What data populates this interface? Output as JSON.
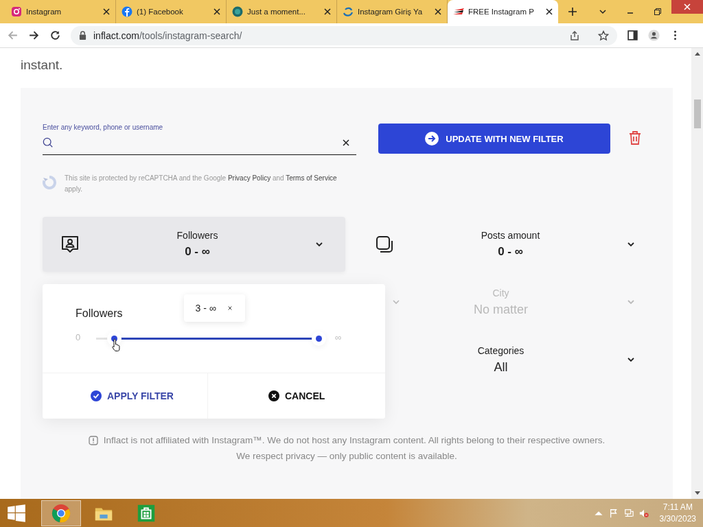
{
  "browser": {
    "tabs": [
      {
        "title": "Instagram",
        "selected": false
      },
      {
        "title": "(1) Facebook",
        "selected": false
      },
      {
        "title": "Just a moment...",
        "selected": false
      },
      {
        "title": "Instagram Giriş Ya",
        "selected": false
      },
      {
        "title": "FREE Instagram P",
        "selected": true
      }
    ],
    "address_host": "inflact.com",
    "address_path": "/tools/instagram-search/"
  },
  "page": {
    "intro_tail": "instant.",
    "search": {
      "label": "Enter any keyword, phone or username"
    },
    "update_button": "UPDATE WITH NEW FILTER",
    "recaptcha": {
      "before": "This site is protected by reCAPTCHA and the Google",
      "privacy_link": "Privacy Policy",
      "middle": "and",
      "terms_link": "Terms of Service",
      "after": "apply."
    },
    "filters": [
      {
        "kind": "range",
        "label": "Followers",
        "value": "0 - ∞",
        "active": true,
        "disabled": false
      },
      {
        "kind": "range",
        "label": "Posts amount",
        "value": "0 - ∞",
        "active": false,
        "disabled": false
      },
      {
        "kind": "covered",
        "disabled": true
      },
      {
        "kind": "select",
        "label": "City",
        "value": "No matter",
        "disabled": true
      },
      {
        "kind": "covered"
      },
      {
        "kind": "select",
        "label": "Categories",
        "value": "All",
        "disabled": false
      }
    ],
    "popup": {
      "title": "Followers",
      "tooltip": "3 - ∞",
      "min_label": "0",
      "max_label": "∞",
      "handles": [
        {
          "level": 0.08
        },
        {
          "level": 1
        }
      ],
      "apply": "APPLY FILTER",
      "cancel": "CANCEL"
    },
    "disclaimer": [
      "Inflact is not affiliated with Instagram™. We do not host any Instagram content. All rights belong to their respective owners.",
      "We respect privacy — only public content is available."
    ]
  },
  "taskbar": {
    "apps": [
      {
        "kind": "chrome",
        "selected": true
      },
      {
        "kind": "explorer",
        "selected": false
      },
      {
        "kind": "store",
        "selected": false
      }
    ],
    "time": "7:11 AM",
    "date": "3/30/2023"
  }
}
